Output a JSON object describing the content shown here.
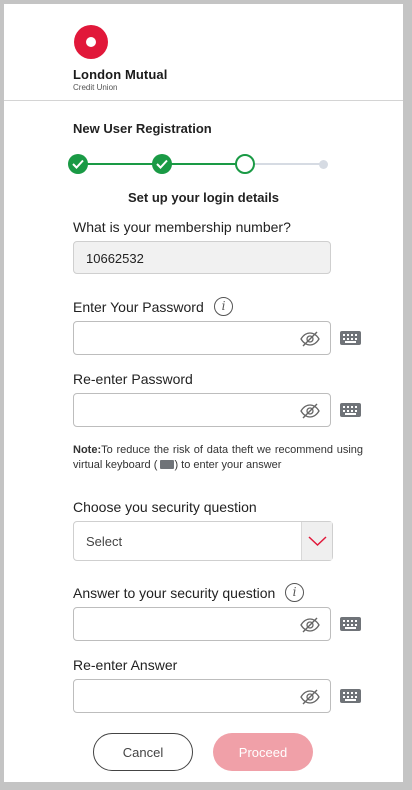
{
  "brand": {
    "name": "London Mutual",
    "sub": "Credit Union"
  },
  "form": {
    "title": "New User Registration",
    "subtitle": "Set up your login details",
    "steps_completed": 2,
    "steps_total": 4,
    "membership_label": "What is your membership number?",
    "membership_value": "10662532",
    "password_label": "Enter Your Password",
    "reenter_password_label": "Re-enter Password",
    "note_prefix": "Note:",
    "note_text_1": "To reduce the risk of data theft we recommend using virtual keyboard (",
    "note_text_2": ") to enter your answer",
    "question_label": "Choose you security question",
    "question_value": "Select",
    "answer_label": "Answer to your security question",
    "reenter_answer_label": "Re-enter Answer",
    "cancel_label": "Cancel",
    "proceed_label": "Proceed"
  },
  "colors": {
    "accent": "#e1183a",
    "success": "#1a9a45",
    "proceed_disabled": "#f0a0a8"
  },
  "icons": {
    "info": "info-icon",
    "eye": "eye-slash-icon",
    "keyboard": "keyboard-icon",
    "select": "chevron-down-icon",
    "check": "check-icon"
  }
}
